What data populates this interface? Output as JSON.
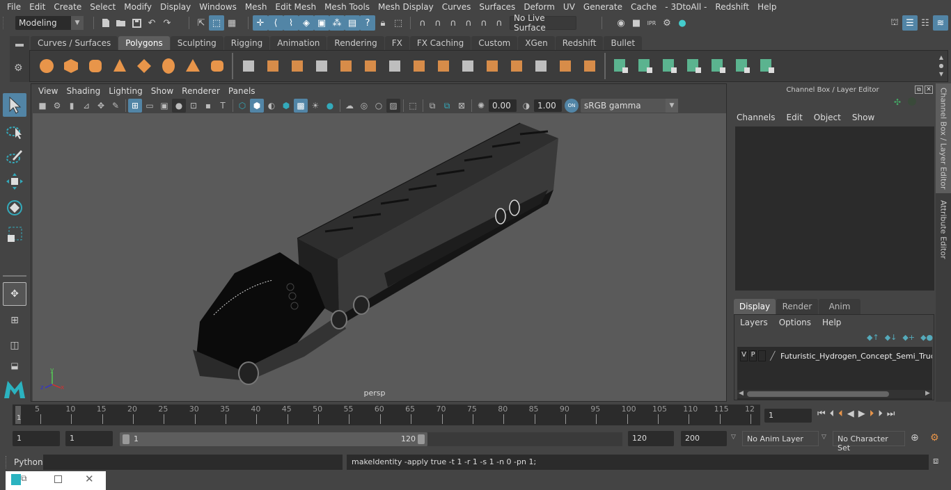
{
  "menubar": {
    "items": [
      "File",
      "Edit",
      "Create",
      "Select",
      "Modify",
      "Display",
      "Windows",
      "Mesh",
      "Edit Mesh",
      "Mesh Tools",
      "Mesh Display",
      "Curves",
      "Surfaces",
      "Deform",
      "UV",
      "Generate",
      "Cache",
      "- 3DtoAll -",
      "Redshift",
      "Help"
    ]
  },
  "statusline": {
    "mode": "Modeling",
    "live_surface": "No Live Surface"
  },
  "shelf": {
    "tabs": [
      "Curves / Surfaces",
      "Polygons",
      "Sculpting",
      "Rigging",
      "Animation",
      "Rendering",
      "FX",
      "FX Caching",
      "Custom",
      "XGen",
      "Redshift",
      "Bullet"
    ],
    "active_tab": "Polygons",
    "poly_icons": [
      "poly-sphere-icon",
      "poly-cube-icon",
      "poly-cylinder-icon",
      "poly-cone-icon",
      "poly-plane-icon",
      "poly-torus-icon",
      "poly-pyramid-icon",
      "poly-pipe-icon"
    ],
    "edit_icons": [
      "combine-icon",
      "separate-icon",
      "mirror-icon",
      "smooth-icon",
      "extract-icon",
      "bridge-icon",
      "multi-cut-icon",
      "extrude-icon",
      "bevel-icon",
      "fill-hole-icon",
      "merge-icon",
      "insert-edge-loop-icon",
      "append-icon",
      "target-weld-icon",
      "quad-draw-icon"
    ],
    "uv_icons": [
      "planar-map-icon",
      "cylindrical-map-icon",
      "spherical-map-icon",
      "automatic-map-icon",
      "unfold-icon",
      "uv-editor-icon",
      "layout-uv-icon"
    ],
    "accent_orange": "#e8954a",
    "accent_green": "#5bb38f"
  },
  "viewport": {
    "menu": [
      "View",
      "Shading",
      "Lighting",
      "Show",
      "Renderer",
      "Panels"
    ],
    "exposure": "0.00",
    "gamma": "1.00",
    "color_mgmt_toggle": "ON",
    "color_space": "sRGB gamma",
    "camera_label": "persp",
    "axis_labels": {
      "x": "x",
      "y": "y",
      "z": "z"
    }
  },
  "channel_box": {
    "title": "Channel Box / Layer Editor",
    "menu": [
      "Channels",
      "Edit",
      "Object",
      "Show"
    ]
  },
  "layer_editor": {
    "tabs": [
      "Display",
      "Render",
      "Anim"
    ],
    "active_tab": "Display",
    "menu": [
      "Layers",
      "Options",
      "Help"
    ],
    "layers": [
      {
        "v": "V",
        "p": "P",
        "name": "Futuristic_Hydrogen_Concept_Semi_Truck_v"
      }
    ]
  },
  "side_tabs": [
    "Channel Box / Layer Editor",
    "Attribute Editor"
  ],
  "timeline": {
    "ticks": [
      "5",
      "10",
      "15",
      "20",
      "25",
      "30",
      "35",
      "40",
      "45",
      "50",
      "55",
      "60",
      "65",
      "70",
      "75",
      "80",
      "85",
      "90",
      "95",
      "100",
      "105",
      "110",
      "115",
      "12"
    ],
    "start_marker": "1",
    "current_frame": "1"
  },
  "range": {
    "start_frame": "1",
    "playback_start": "1",
    "slider_start": "1",
    "slider_end": "120",
    "playback_end": "120",
    "end_frame": "200",
    "anim_layer": "No Anim Layer",
    "character_set": "No Character Set"
  },
  "command_line": {
    "language": "Python",
    "input": "",
    "result": "makeIdentity -apply true -t 1 -r 1 -s 1 -n 0 -pn 1;"
  }
}
